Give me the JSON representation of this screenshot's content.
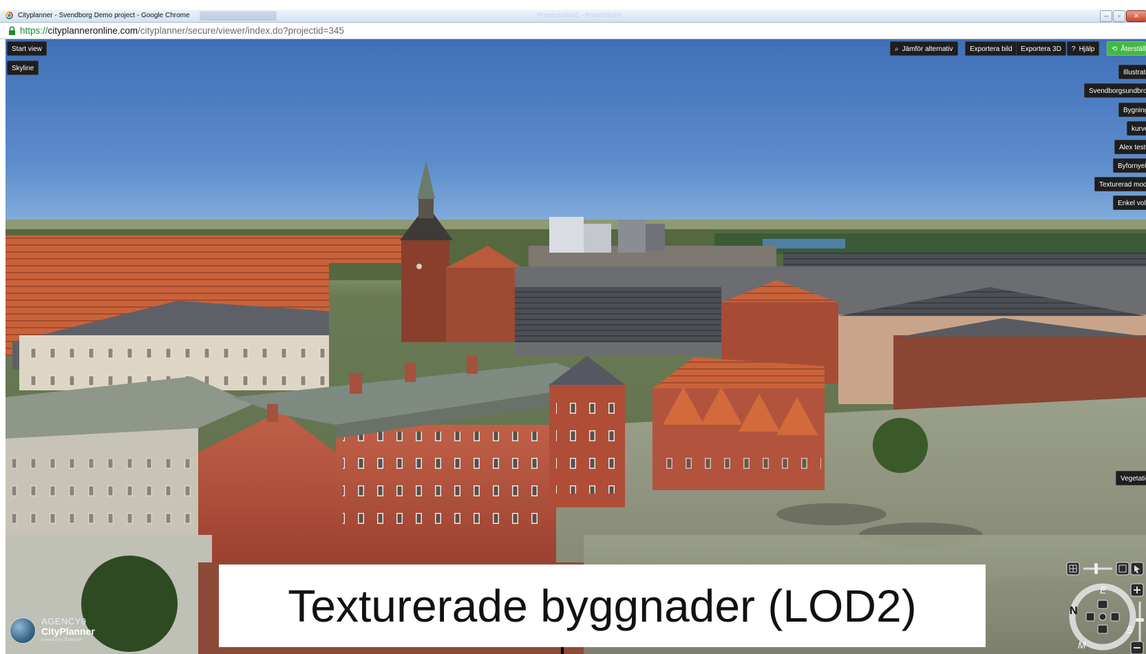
{
  "browser": {
    "window_title": "Cityplanner - Svendborg Demo project - Google Chrome",
    "ghost_title": "Presentation1 - PowerPoint",
    "url_scheme": "https://",
    "url_host": "cityplanneronline.com",
    "url_path": "/cityplanner/secure/viewer/index.do?projectid=345"
  },
  "viewer": {
    "left_buttons": [
      "Start view",
      "Skyline"
    ],
    "toolbar": {
      "compare": "Jämför alternativ",
      "export_image": "Exportera bild",
      "export_3d": "Exportera 3D",
      "help": "Hjälp",
      "help_icon": "?",
      "restore": "Återställ"
    },
    "layers": [
      "Illustration",
      "Svendborgsundbroen",
      "Bygning",
      "kurve",
      "Alex test",
      "Byfornyels",
      "Texturerad model",
      "Enkel volym",
      "Vegetation"
    ],
    "compass": {
      "e": "E",
      "n": "N",
      "s": "S",
      "w": "W",
      "m": "M"
    }
  },
  "caption": "Texturerade byggnader (LOD2)",
  "logo": {
    "line1": "AGENCY9",
    "line2": "CityPlanner",
    "line3": "powered by 3DMaps®"
  },
  "colors": {
    "sky_top": "#3f6fb6",
    "ground": "#6a7a55",
    "button_bg": "#1e1e1e",
    "restore_green": "#44b844",
    "brick": "#b4503a"
  },
  "icons": [
    "search-icon",
    "help-icon",
    "restore-icon",
    "lock-icon",
    "arrow-up-icon",
    "compass-icon"
  ]
}
